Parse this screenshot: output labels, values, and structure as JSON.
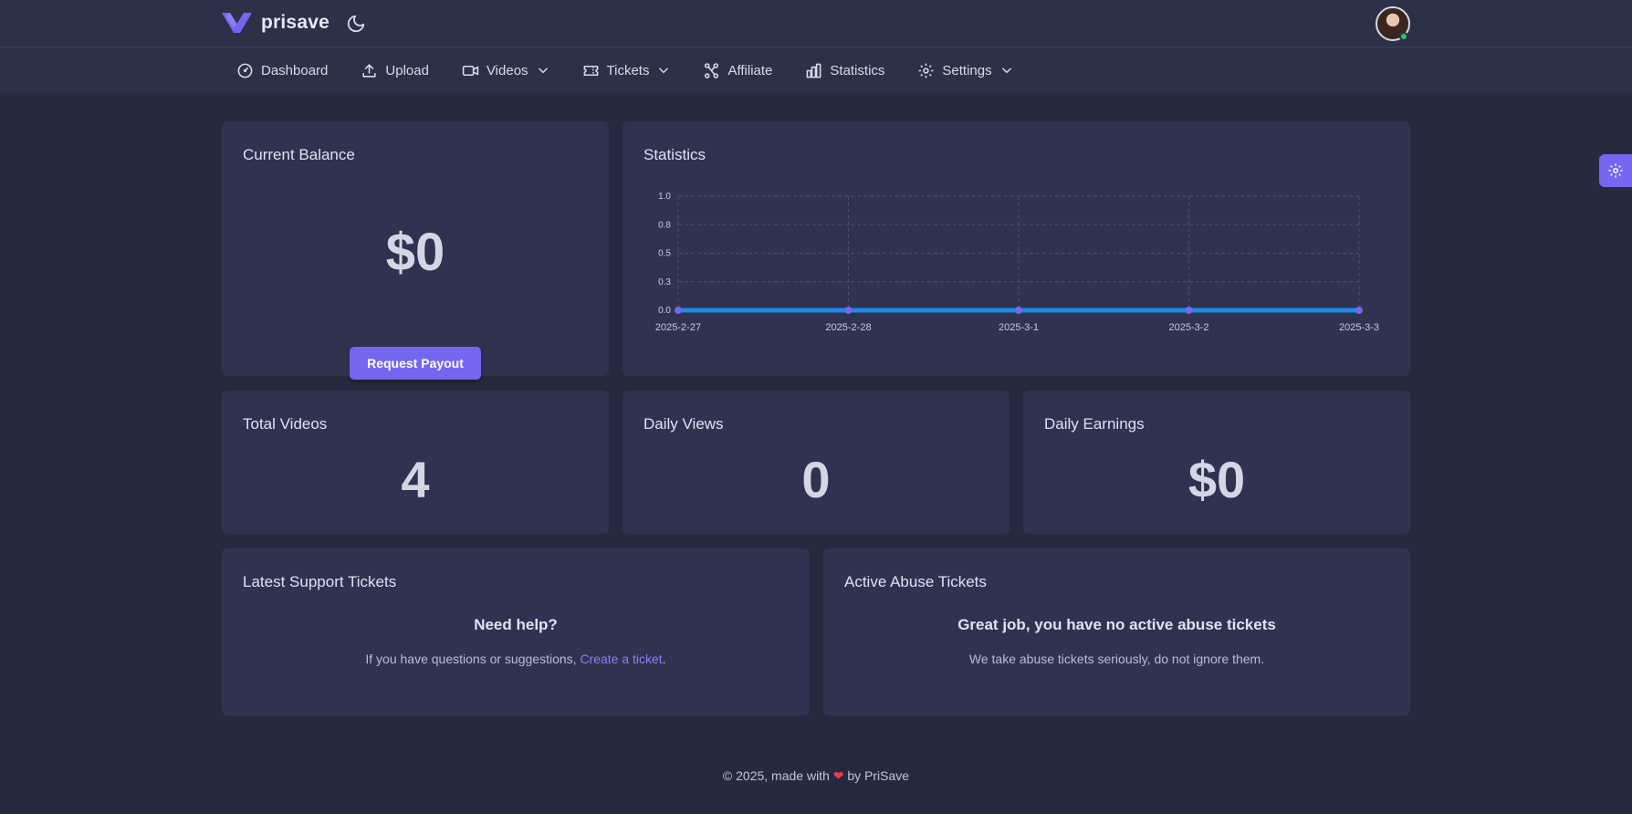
{
  "brand": {
    "name": "prisave",
    "accent": "#7367f0"
  },
  "nav": {
    "items": [
      {
        "label": "Dashboard",
        "icon": "speedometer-icon"
      },
      {
        "label": "Upload",
        "icon": "upload-icon"
      },
      {
        "label": "Videos",
        "icon": "video-icon",
        "dropdown": true
      },
      {
        "label": "Tickets",
        "icon": "ticket-icon",
        "dropdown": true
      },
      {
        "label": "Affiliate",
        "icon": "affiliate-icon"
      },
      {
        "label": "Statistics",
        "icon": "bar-chart-icon"
      },
      {
        "label": "Settings",
        "icon": "gear-icon",
        "dropdown": true
      }
    ]
  },
  "balance": {
    "title": "Current Balance",
    "value": "$0",
    "button": "Request Payout"
  },
  "statistics": {
    "title": "Statistics"
  },
  "chart_data": {
    "type": "line",
    "x": [
      "2025-2-27",
      "2025-2-28",
      "2025-3-1",
      "2025-3-2",
      "2025-3-3"
    ],
    "series": [
      {
        "values": [
          0,
          0,
          0,
          0,
          0
        ],
        "color": "#1e88e5",
        "point_color": "#7367f0"
      }
    ],
    "yticks": [
      "0.0",
      "0.3",
      "0.5",
      "0.8",
      "1.0"
    ],
    "ylim": [
      0,
      1
    ],
    "grid": true
  },
  "stats": [
    {
      "title": "Total Videos",
      "value": "4"
    },
    {
      "title": "Daily Views",
      "value": "0"
    },
    {
      "title": "Daily Earnings",
      "value": "$0"
    }
  ],
  "support": {
    "title": "Latest Support Tickets",
    "heading": "Need help?",
    "text": "If you have questions or suggestions, ",
    "link": "Create a ticket",
    "text_end": "."
  },
  "abuse": {
    "title": "Active Abuse Tickets",
    "heading": "Great job, you have no active abuse tickets",
    "text": "We take abuse tickets seriously, do not ignore them."
  },
  "footer": {
    "prefix": "© 2025, made with ",
    "heart": "❤",
    "suffix": " by PriSave"
  }
}
